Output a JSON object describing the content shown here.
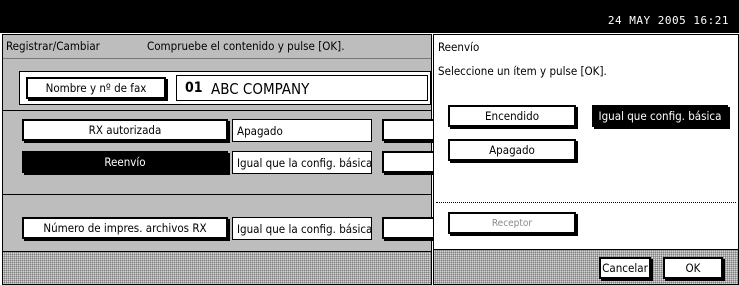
{
  "status_bar": {
    "datetime": "24 MAY  2005 16:21"
  },
  "panel": {
    "title": "Registrar/Cambiar",
    "instruction": "Compruebe el contenido y pulse [OK].",
    "fax_label": "Nombre y nº de fax",
    "fax_number": "01",
    "fax_name": "ABC COMPANY",
    "rows": [
      {
        "label": "RX autorizada",
        "value": "Apagado"
      },
      {
        "label": "Reenvío",
        "value": "Igual que la config. básica"
      },
      {
        "label": "Número de impres. archivos RX",
        "value": "Igual que la config. básica"
      }
    ]
  },
  "dialog": {
    "title": "Reenvío",
    "instruction": "Seleccione un ítem y pulse [OK].",
    "options": {
      "on": "Encendido",
      "same": "Igual que config. básica",
      "off": "Apagado",
      "receiver": "Receptor"
    },
    "cancel": "Cancelar",
    "ok": "OK"
  }
}
